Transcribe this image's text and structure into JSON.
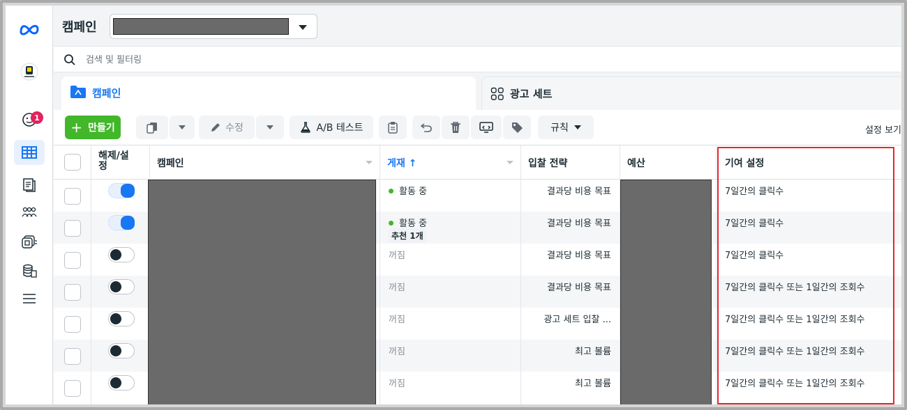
{
  "brand": {
    "logo_icon": "meta-icon",
    "accent": "#1877f2",
    "create_color": "#42b72a",
    "highlight_color": "#e8242b"
  },
  "rail": {
    "notifications_badge": "1"
  },
  "header": {
    "title": "캠페인"
  },
  "search": {
    "placeholder": "검색 및 필터링"
  },
  "tabs": [
    {
      "label": "캠페인",
      "icon": "folder-icon",
      "active": true
    },
    {
      "label": "광고 세트",
      "icon": "grid-icon",
      "active": false
    }
  ],
  "toolbar": {
    "create_label": "만들기",
    "edit_label": "수정",
    "ab_test_label": "A/B 테스트",
    "rules_label": "규칙",
    "view_settings_label": "설정 보기"
  },
  "table": {
    "columns": {
      "toggle": "해제/설\n정",
      "campaign": "캠페인",
      "delivery": "게재 ↑",
      "bid_strategy": "입찰 전략",
      "budget": "예산",
      "attribution": "기여 설정"
    },
    "rows": [
      {
        "on": true,
        "delivery": "활동 중",
        "active": true,
        "recommendation": "",
        "bid_strategy": "결과당 비용 목표",
        "attribution": "7일간의 클릭수"
      },
      {
        "on": true,
        "delivery": "활동 중",
        "active": true,
        "recommendation": "추천 1개",
        "bid_strategy": "결과당 비용 목표",
        "attribution": "7일간의 클릭수"
      },
      {
        "on": false,
        "delivery": "꺼짐",
        "active": false,
        "recommendation": "",
        "bid_strategy": "결과당 비용 목표",
        "attribution": "7일간의 클릭수"
      },
      {
        "on": false,
        "delivery": "꺼짐",
        "active": false,
        "recommendation": "",
        "bid_strategy": "결과당 비용 목표",
        "attribution": "7일간의 클릭수 또는 1일간의 조회수"
      },
      {
        "on": false,
        "delivery": "꺼짐",
        "active": false,
        "recommendation": "",
        "bid_strategy": "광고 세트 입찰 ...",
        "attribution": "7일간의 클릭수 또는 1일간의 조회수"
      },
      {
        "on": false,
        "delivery": "꺼짐",
        "active": false,
        "recommendation": "",
        "bid_strategy": "최고 볼륨",
        "attribution": "7일간의 클릭수 또는 1일간의 조회수"
      },
      {
        "on": false,
        "delivery": "꺼짐",
        "active": false,
        "recommendation": "",
        "bid_strategy": "최고 볼륨",
        "attribution": "7일간의 클릭수 또는 1일간의 조회수"
      }
    ]
  }
}
